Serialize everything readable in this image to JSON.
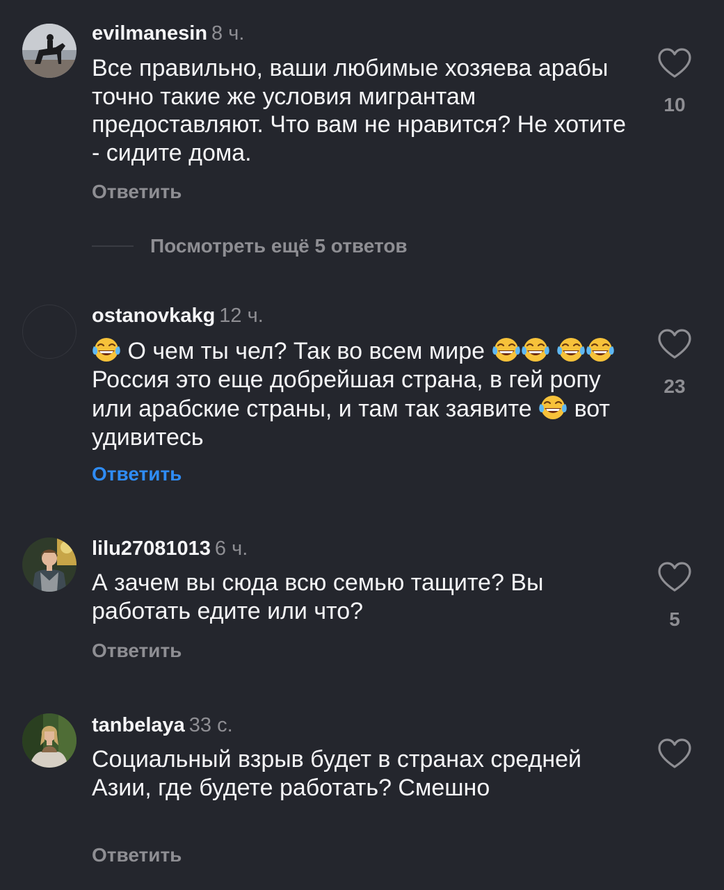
{
  "colors": {
    "background": "#24262d",
    "text": "#f5f5f7",
    "secondary": "#8e8e93",
    "accent": "#2f8cf5"
  },
  "comments": [
    {
      "username": "evilmanesin",
      "time": "8 ч.",
      "text": "Все правильно, ваши любимые хозяева арабы точно такие же условия мигрантам предоставляют. Что вам не нравится? Не хотите - сидите дома.",
      "reply_label": "Ответить",
      "likes": "10",
      "icon": "heart-outline-icon"
    },
    {
      "username": "ostanovkakg",
      "time": "12 ч.",
      "text_parts": {
        "p1": "О чем ты чел? Так во всем мире",
        "p2": "Россия это еще добрейшая страна, в гей ропу или арабские страны,  и там так заявите",
        "p3": "вот удивитесь"
      },
      "emoji": "face-with-tears-of-joy-icon",
      "reply_label": "Ответить",
      "likes": "23",
      "icon": "heart-outline-icon"
    },
    {
      "username": "lilu27081013",
      "time": "6 ч.",
      "text": "А зачем вы сюда всю семью тащите? Вы работать едите или что?",
      "reply_label": "Ответить",
      "likes": "5",
      "icon": "heart-outline-icon"
    },
    {
      "username": "tanbelaya",
      "time": "33 с.",
      "text": "Социальный взрыв будет в странах средней Азии,  где будете работать? Смешно",
      "reply_label": "Ответить",
      "icon": "heart-outline-icon"
    }
  ],
  "more_replies": {
    "label": "Посмотреть ещё 5 ответов"
  }
}
